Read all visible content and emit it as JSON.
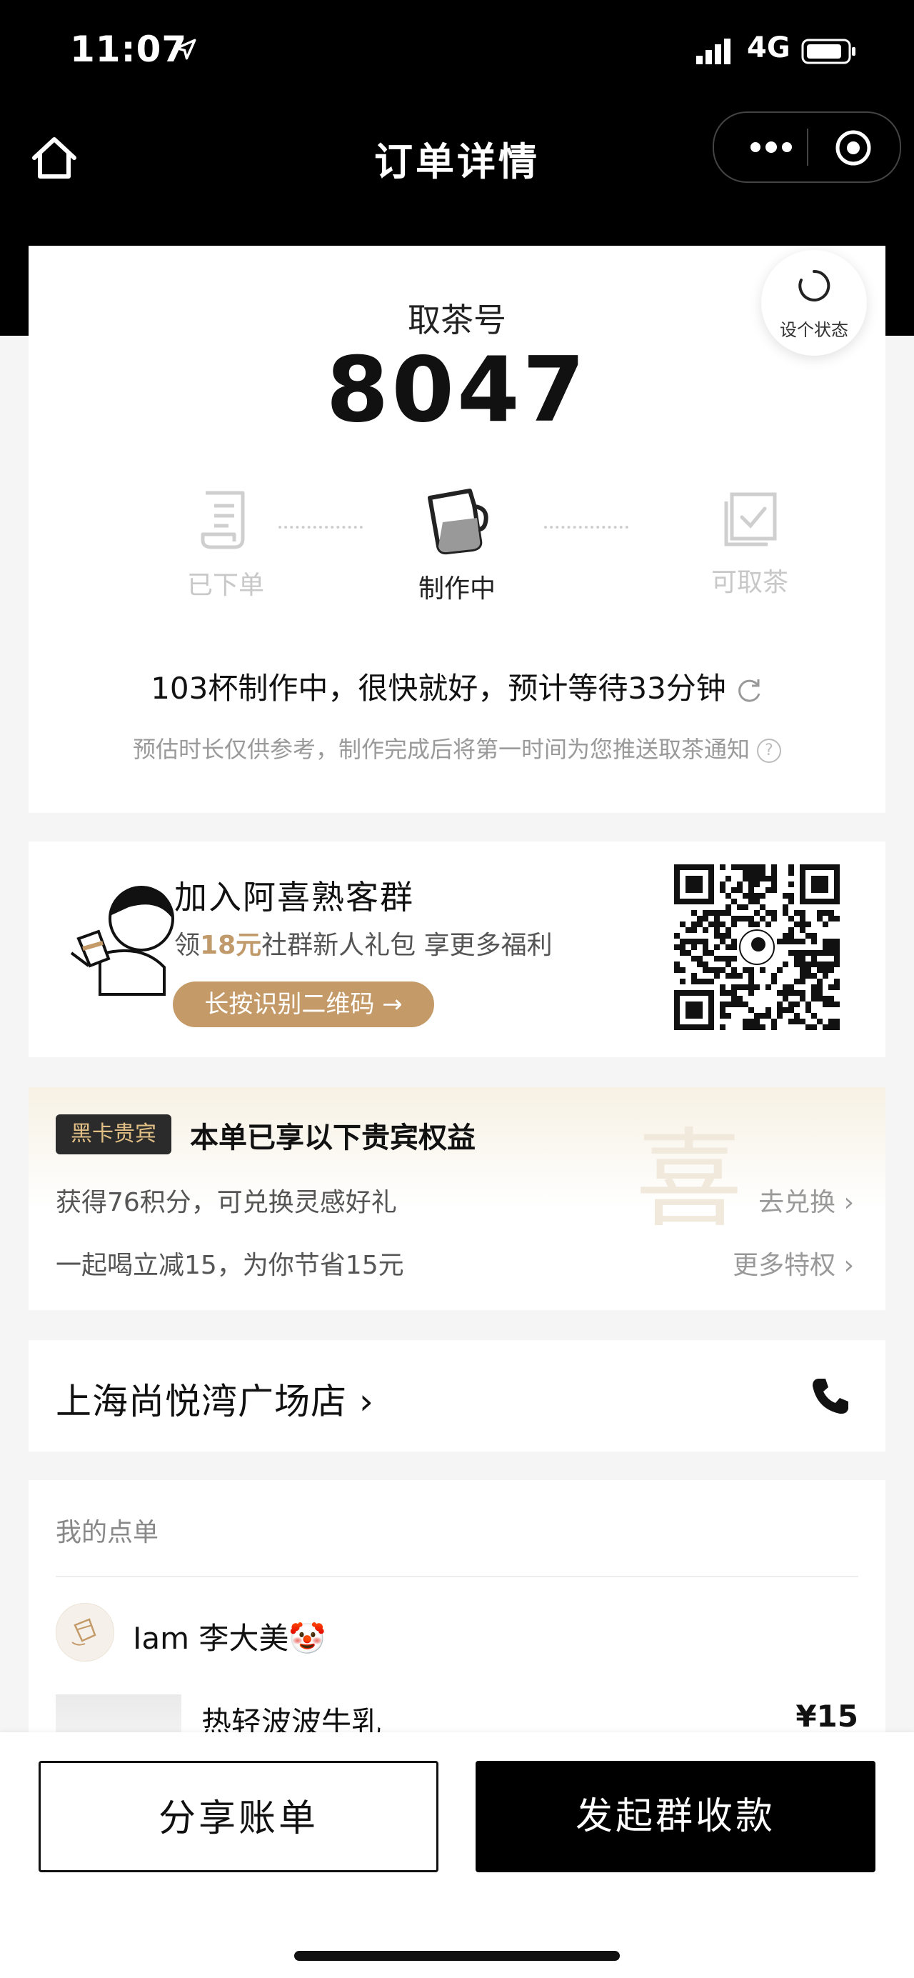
{
  "status_bar": {
    "time": "11:07",
    "network": "4G"
  },
  "nav": {
    "title": "订单详情"
  },
  "order_status": {
    "status_button_label": "设个状态",
    "pick_label": "取茶号",
    "pick_number": "8047",
    "steps": [
      {
        "label": "已下单",
        "active": false
      },
      {
        "label": "制作中",
        "active": true
      },
      {
        "label": "可取茶",
        "active": false
      }
    ],
    "wait_text": "103杯制作中，很快就好，预计等待33分钟",
    "tip": "预估时长仅供参考，制作完成后将第一时间为您推送取茶通知"
  },
  "group": {
    "title": "加入阿喜熟客群",
    "sub_prefix": "领",
    "sub_amount": "18元",
    "sub_suffix": "社群新人礼包 享更多福利",
    "button": "长按识别二维码 →"
  },
  "vip": {
    "badge": "黑卡贵宾",
    "title": "本单已享以下贵宾权益",
    "watermark": "喜",
    "benefits": [
      {
        "text": "获得76积分，可兑换灵感好礼",
        "link": "去兑换 ›"
      },
      {
        "text": "一起喝立减15，为你节省15元",
        "link": "更多特权 ›"
      }
    ]
  },
  "store": {
    "name": "上海尚悦湾广场店 ›"
  },
  "my_order": {
    "header": "我的点单",
    "user_name": "Iam 李大美🤡",
    "items": [
      {
        "name": "热轻波波牛乳",
        "price": "¥15"
      }
    ]
  },
  "actions": {
    "share": "分享账单",
    "group_pay": "发起群收款"
  },
  "colors": {
    "accent_gold": "#c49b68",
    "primary": "#000000"
  }
}
